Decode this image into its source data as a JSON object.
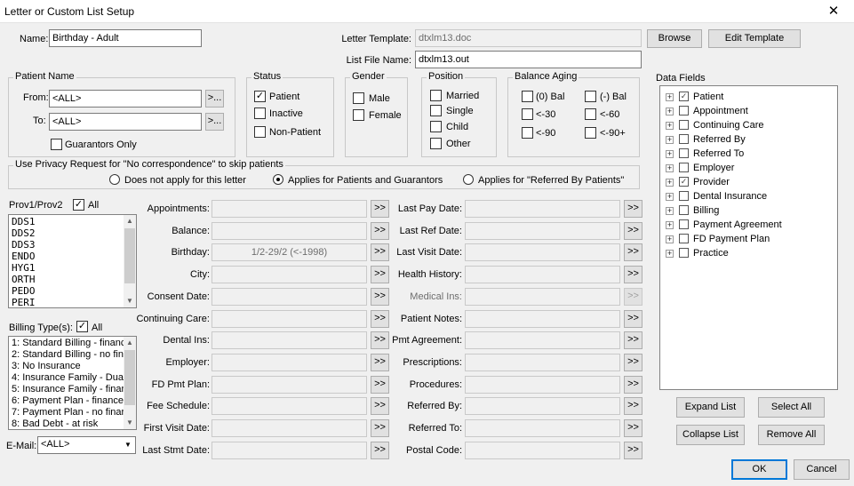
{
  "window": {
    "title": "Letter or Custom List Setup"
  },
  "name": {
    "label": "Name:",
    "value": "Birthday - Adult"
  },
  "letter_template": {
    "label": "Letter Template:",
    "value": "dtxlm13.doc"
  },
  "list_file": {
    "label": "List File Name:",
    "value": "dtxlm13.out"
  },
  "buttons": {
    "browse": "Browse",
    "edit_template": "Edit Template",
    "expand_list": "Expand List",
    "select_all": "Select All",
    "collapse_list": "Collapse List",
    "remove_all": "Remove All",
    "ok": "OK",
    "cancel": "Cancel",
    "ellipsis": ">...",
    "arrows": ">>"
  },
  "patient_name": {
    "title": "Patient Name",
    "from_label": "From:",
    "from_value": "<ALL>",
    "to_label": "To:",
    "to_value": "<ALL>",
    "guarantors_only": "Guarantors Only"
  },
  "status": {
    "title": "Status",
    "items": [
      {
        "label": "Patient",
        "checked": true
      },
      {
        "label": "Inactive",
        "checked": false
      },
      {
        "label": "Non-Patient",
        "checked": false
      }
    ]
  },
  "gender": {
    "title": "Gender",
    "items": [
      {
        "label": "Male",
        "checked": false
      },
      {
        "label": "Female",
        "checked": false
      }
    ]
  },
  "position": {
    "title": "Position",
    "items": [
      {
        "label": "Married",
        "checked": false
      },
      {
        "label": "Single",
        "checked": false
      },
      {
        "label": "Child",
        "checked": false
      },
      {
        "label": "Other",
        "checked": false
      }
    ]
  },
  "balance_aging": {
    "title": "Balance Aging",
    "items": [
      {
        "label": "(0) Bal",
        "checked": false
      },
      {
        "label": "(-) Bal",
        "checked": false
      },
      {
        "label": "<-30",
        "checked": false
      },
      {
        "label": "<-60",
        "checked": false
      },
      {
        "label": "<-90",
        "checked": false
      },
      {
        "label": "<-90+",
        "checked": false
      }
    ]
  },
  "privacy": {
    "title": "Use Privacy Request for \"No correspondence\" to skip patients",
    "options": [
      {
        "label": "Does not apply for this letter",
        "selected": false
      },
      {
        "label": "Applies for Patients and Guarantors",
        "selected": true
      },
      {
        "label": "Applies for \"Referred By Patients\"",
        "selected": false
      }
    ]
  },
  "prov": {
    "label": "Prov1/Prov2",
    "all_label": "All",
    "all_checked": true,
    "items": [
      "DDS1",
      "DDS2",
      "DDS3",
      "ENDO",
      "HYG1",
      "ORTH",
      "PEDO",
      "PERI"
    ]
  },
  "billing": {
    "label": "Billing Type(s):",
    "all_label": "All",
    "all_checked": true,
    "items": [
      "1: Standard Billing - finance",
      "2: Standard Billing - no fin",
      "3: No Insurance",
      "4: Insurance Family - Dua",
      "5: Insurance Family - finar",
      "6: Payment Plan - finance",
      "7: Payment Plan - no finar",
      "8: Bad Debt - at risk"
    ]
  },
  "email": {
    "label": "E-Mail:",
    "value": "<ALL>"
  },
  "criteria_left": [
    {
      "label": "Appointments:",
      "value": "",
      "enabled": true
    },
    {
      "label": "Balance:",
      "value": "",
      "enabled": true
    },
    {
      "label": "Birthday:",
      "value": "1/2-29/2 (<-1998)",
      "enabled": true
    },
    {
      "label": "City:",
      "value": "",
      "enabled": true
    },
    {
      "label": "Consent Date:",
      "value": "",
      "enabled": true
    },
    {
      "label": "Continuing Care:",
      "value": "",
      "enabled": true
    },
    {
      "label": "Dental Ins:",
      "value": "",
      "enabled": true
    },
    {
      "label": "Employer:",
      "value": "",
      "enabled": true
    },
    {
      "label": "FD Pmt Plan:",
      "value": "",
      "enabled": true
    },
    {
      "label": "Fee Schedule:",
      "value": "",
      "enabled": true
    },
    {
      "label": "First Visit Date:",
      "value": "",
      "enabled": true
    },
    {
      "label": "Last Stmt Date:",
      "value": "",
      "enabled": true
    }
  ],
  "criteria_right": [
    {
      "label": "Last Pay Date:",
      "value": "",
      "enabled": true
    },
    {
      "label": "Last Ref Date:",
      "value": "",
      "enabled": true
    },
    {
      "label": "Last Visit Date:",
      "value": "",
      "enabled": true
    },
    {
      "label": "Health History:",
      "value": "",
      "enabled": true
    },
    {
      "label": "Medical Ins:",
      "value": "",
      "enabled": false
    },
    {
      "label": "Patient Notes:",
      "value": "",
      "enabled": true
    },
    {
      "label": "Pmt Agreement:",
      "value": "",
      "enabled": true
    },
    {
      "label": "Prescriptions:",
      "value": "",
      "enabled": true
    },
    {
      "label": "Procedures:",
      "value": "",
      "enabled": true
    },
    {
      "label": "Referred By:",
      "value": "",
      "enabled": true
    },
    {
      "label": "Referred To:",
      "value": "",
      "enabled": true
    },
    {
      "label": "Postal Code:",
      "value": "",
      "enabled": true
    }
  ],
  "data_fields": {
    "title": "Data Fields",
    "items": [
      {
        "label": "Patient",
        "checked": true
      },
      {
        "label": "Appointment",
        "checked": false
      },
      {
        "label": "Continuing Care",
        "checked": false
      },
      {
        "label": "Referred By",
        "checked": false
      },
      {
        "label": "Referred To",
        "checked": false
      },
      {
        "label": "Employer",
        "checked": false
      },
      {
        "label": "Provider",
        "checked": true
      },
      {
        "label": "Dental Insurance",
        "checked": false
      },
      {
        "label": "Billing",
        "checked": false
      },
      {
        "label": "Payment Agreement",
        "checked": false
      },
      {
        "label": "FD Payment Plan",
        "checked": false
      },
      {
        "label": "Practice",
        "checked": false
      }
    ]
  }
}
